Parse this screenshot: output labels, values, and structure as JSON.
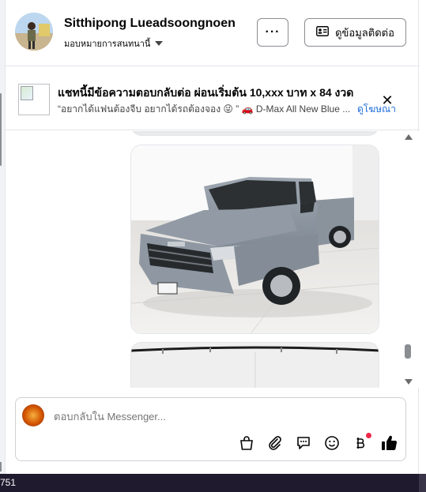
{
  "header": {
    "name": "Sitthipong Lueadsoongnoen",
    "subtitle": "มอบหมายการสนทนานี้",
    "more_label": "···",
    "contact_label": "ดูข้อมูลติดต่อ"
  },
  "ad": {
    "title": "แชทนี้มีข้อความตอบกลับต่อ ผ่อนเริ่มต้น 10,xxx บาท x 84 งวด",
    "subtitle": "“อยากได้แฟนต้องจีบ อยากได้รถต้องจอง 😜 ” 🚗 D-Max All New Blue ...",
    "link": "ดูโฆษณา",
    "close": "✕"
  },
  "composer": {
    "placeholder": "ตอบกลับใน Messenger..."
  },
  "taskbar": {
    "text": "751"
  },
  "colors": {
    "link": "#216fdb",
    "border": "#e4e6eb",
    "badge": "#f02849",
    "taskbar": "#1f1a2e"
  },
  "icons": [
    "contact-card-icon",
    "close-icon",
    "chevron-down-icon",
    "shopping-bag-icon",
    "paperclip-icon",
    "saved-reply-icon",
    "emoji-icon",
    "baht-payment-icon",
    "thumbs-up-icon"
  ]
}
